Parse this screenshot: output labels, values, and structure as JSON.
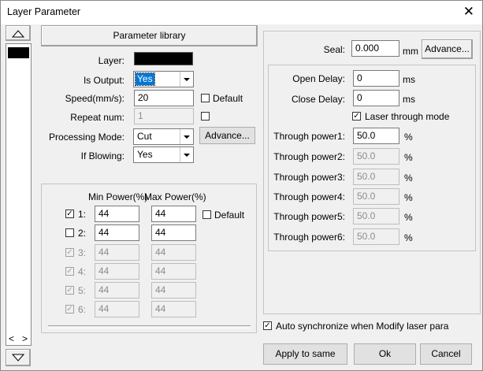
{
  "window": {
    "title": "Layer Parameter",
    "close_label": "✕"
  },
  "left_strip": {
    "up_icon": "triangle-up-icon",
    "down_icon": "triangle-down-icon",
    "scroll_left": "<",
    "scroll_right": ">",
    "layer_color": "#000000"
  },
  "param_library_label": "Parameter library",
  "layer": {
    "label": "Layer:",
    "color": "#000000"
  },
  "is_output": {
    "label": "Is Output:",
    "value": "Yes"
  },
  "speed": {
    "label": "Speed(mm/s):",
    "value": "20",
    "default_label": "Default"
  },
  "repeat": {
    "label": "Repeat num:",
    "value": "1"
  },
  "processing_mode": {
    "label": "Processing Mode:",
    "value": "Cut",
    "advance_label": "Advance..."
  },
  "if_blowing": {
    "label": "If Blowing:",
    "value": "Yes"
  },
  "power": {
    "min_header": "Min Power(%)",
    "max_header": "Max Power(%)",
    "default_label": "Default",
    "rows": [
      {
        "label": "1:",
        "checked": true,
        "enabled": true,
        "min": "44",
        "max": "44"
      },
      {
        "label": "2:",
        "checked": false,
        "enabled": true,
        "min": "44",
        "max": "44"
      },
      {
        "label": "3:",
        "checked": true,
        "enabled": false,
        "min": "44",
        "max": "44"
      },
      {
        "label": "4:",
        "checked": true,
        "enabled": false,
        "min": "44",
        "max": "44"
      },
      {
        "label": "5:",
        "checked": true,
        "enabled": false,
        "min": "44",
        "max": "44"
      },
      {
        "label": "6:",
        "checked": true,
        "enabled": false,
        "min": "44",
        "max": "44"
      }
    ]
  },
  "seal": {
    "label": "Seal:",
    "value": "0.000",
    "unit": "mm",
    "advance_label": "Advance..."
  },
  "open_delay": {
    "label": "Open Delay:",
    "value": "0",
    "unit": "ms"
  },
  "close_delay": {
    "label": "Close Delay:",
    "value": "0",
    "unit": "ms"
  },
  "laser_through_mode": {
    "label": "Laser through mode",
    "checked": true
  },
  "through_power": [
    {
      "label": "Through power1:",
      "value": "50.0",
      "unit": "%",
      "enabled": true
    },
    {
      "label": "Through power2:",
      "value": "50.0",
      "unit": "%",
      "enabled": false
    },
    {
      "label": "Through power3:",
      "value": "50.0",
      "unit": "%",
      "enabled": false
    },
    {
      "label": "Through power4:",
      "value": "50.0",
      "unit": "%",
      "enabled": false
    },
    {
      "label": "Through power5:",
      "value": "50.0",
      "unit": "%",
      "enabled": false
    },
    {
      "label": "Through power6:",
      "value": "50.0",
      "unit": "%",
      "enabled": false
    }
  ],
  "auto_sync": {
    "label": "Auto synchronize when Modify laser para",
    "checked": true
  },
  "buttons": {
    "apply_to_same": "Apply to same",
    "ok": "Ok",
    "cancel": "Cancel"
  },
  "check_glyph": "✓"
}
